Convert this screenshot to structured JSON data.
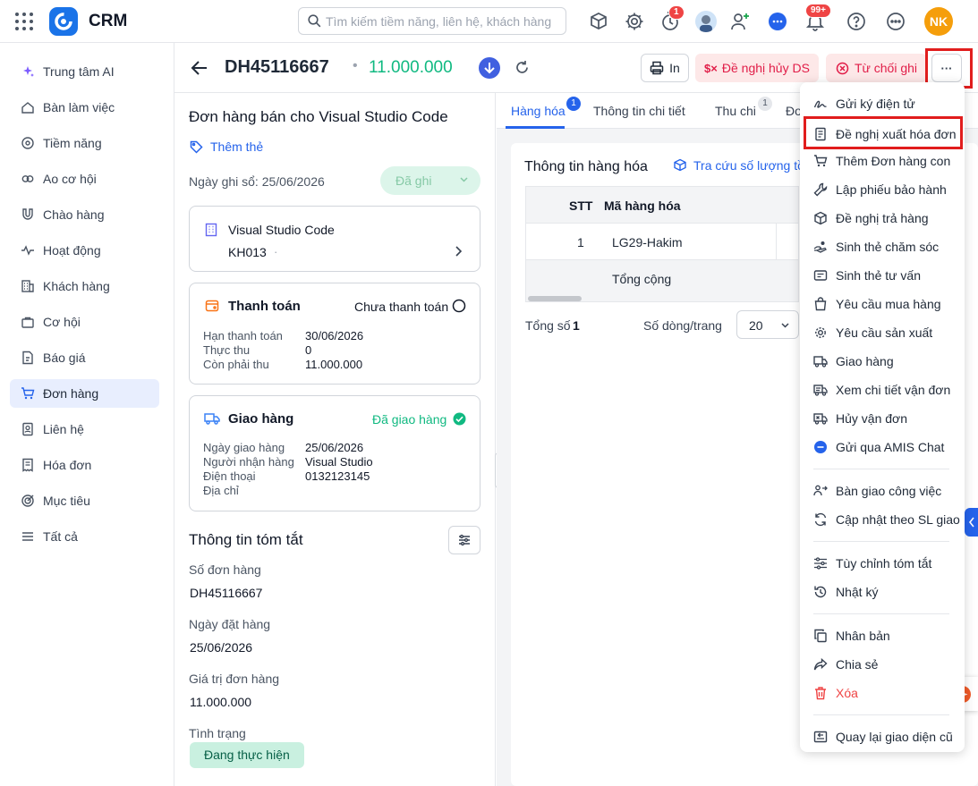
{
  "app": {
    "name": "CRM"
  },
  "search": {
    "placeholder": "Tìm kiếm tiềm năng, liên hệ, khách hàng"
  },
  "topbar": {
    "timer_badge": "1",
    "notif_badge": "99+",
    "user_initials": "NK",
    "brand_color": "#1a73e8",
    "avatar_color": "#f59e0b"
  },
  "sidebar": {
    "items": [
      {
        "label": "Trung tâm AI",
        "icon": "sparkle-icon"
      },
      {
        "label": "Bàn làm việc",
        "icon": "home-icon"
      },
      {
        "label": "Tiềm năng",
        "icon": "target-icon"
      },
      {
        "label": "Ao cơ hội",
        "icon": "pond-icon"
      },
      {
        "label": "Chào hàng",
        "icon": "magnet-icon"
      },
      {
        "label": "Hoạt động",
        "icon": "pulse-icon"
      },
      {
        "label": "Khách hàng",
        "icon": "building-icon"
      },
      {
        "label": "Cơ hội",
        "icon": "bag-icon"
      },
      {
        "label": "Báo giá",
        "icon": "quote-icon"
      },
      {
        "label": "Đơn hàng",
        "icon": "cart-icon"
      },
      {
        "label": "Liên hệ",
        "icon": "contact-icon"
      },
      {
        "label": "Hóa đơn",
        "icon": "invoice-icon"
      },
      {
        "label": "Mục tiêu",
        "icon": "goal-icon"
      },
      {
        "label": "Tất cả",
        "icon": "menu-icon"
      }
    ],
    "active_index": 9
  },
  "header": {
    "order_code": "DH45116667",
    "dot": "•",
    "amount": "11.000.000",
    "print_label": "In",
    "cancel_label": "Đề nghị hủy DS",
    "reject_label": "Từ chối ghi",
    "more_label": "···"
  },
  "left": {
    "title": "Đơn hàng bán cho Visual Studio Code",
    "add_tag": "Thêm thẻ",
    "record_date": "Ngày ghi sổ: 25/06/2026",
    "status_select": "Đã ghi",
    "customer": {
      "name": "Visual Studio Code",
      "code": "KH013",
      "sep": "·"
    },
    "payment": {
      "title": "Thanh toán",
      "status": "Chưa thanh toán",
      "rows": [
        {
          "label": "Hạn thanh toán",
          "value": "30/06/2026"
        },
        {
          "label": "Thực thu",
          "value": "0"
        },
        {
          "label": "Còn phải thu",
          "value": "11.000.000"
        }
      ]
    },
    "delivery": {
      "title": "Giao hàng",
      "status": "Đã giao hàng",
      "rows": [
        {
          "label": "Ngày giao hàng",
          "value": "25/06/2026"
        },
        {
          "label": "Người nhận hàng",
          "value": "Visual Studio"
        },
        {
          "label": "Điện thoại",
          "value": "0132123145"
        },
        {
          "label": "Địa chỉ",
          "value": ""
        }
      ]
    },
    "summary": {
      "title": "Thông tin tóm tắt",
      "fields": [
        {
          "label": "Số đơn hàng",
          "value": "DH45116667"
        },
        {
          "label": "Ngày đặt hàng",
          "value": "25/06/2026"
        },
        {
          "label": "Giá trị đơn hàng",
          "value": "11.000.000"
        }
      ],
      "status_label": "Tình trạng",
      "status_value": "Đang thực hiện"
    }
  },
  "tabs": {
    "items": [
      {
        "label": "Hàng hóa",
        "badge": "1"
      },
      {
        "label": "Thông tin chi tiết",
        "badge": ""
      },
      {
        "label": "Thu chi",
        "badge": "1"
      },
      {
        "label": "Đơ",
        "badge": ""
      }
    ],
    "active_index": 0
  },
  "goods": {
    "title": "Thông tin hàng hóa",
    "lookup": "Tra cứu số lượng tồ",
    "columns": [
      "STT",
      "Mã hàng hóa"
    ],
    "rows": [
      {
        "stt": "1",
        "code": "LG29-Hakim"
      }
    ],
    "total_label": "Tổng cộng",
    "total_count_label": "Tổng số",
    "total_count": "1",
    "page_size_label": "Số dòng/trang",
    "page_size": "20"
  },
  "menu": {
    "items": [
      {
        "label": "Gửi ký điện tử",
        "icon": "signature-icon"
      },
      {
        "label": "Đề nghị xuất hóa đơn",
        "icon": "invoice-request-icon"
      },
      {
        "label": "Thêm Đơn hàng con",
        "icon": "cart-add-icon"
      },
      {
        "label": "Lập phiếu bảo hành",
        "icon": "wrench-icon"
      },
      {
        "label": "Đề nghị trả hàng",
        "icon": "box-return-icon"
      },
      {
        "label": "Sinh thẻ chăm sóc",
        "icon": "care-hand-icon"
      },
      {
        "label": "Sinh thẻ tư vấn",
        "icon": "consult-card-icon"
      },
      {
        "label": "Yêu cầu mua hàng",
        "icon": "purchase-bag-icon"
      },
      {
        "label": "Yêu cầu sản xuất",
        "icon": "production-gear-icon"
      },
      {
        "label": "Giao hàng",
        "icon": "truck-icon"
      },
      {
        "label": "Xem chi tiết vận đơn",
        "icon": "waybill-truck-icon"
      },
      {
        "label": "Hủy vận đơn",
        "icon": "cancel-waybill-icon"
      },
      {
        "label": "Gửi qua AMIS Chat",
        "icon": "chat-icon"
      },
      {
        "label": "Bàn giao công việc",
        "icon": "handover-icon"
      },
      {
        "label": "Cập nhật theo SL giao",
        "icon": "refresh-icon"
      },
      {
        "label": "Tùy chỉnh tóm tắt",
        "icon": "sliders-icon"
      },
      {
        "label": "Nhật ký",
        "icon": "history-icon"
      },
      {
        "label": "Nhân bản",
        "icon": "copy-icon"
      },
      {
        "label": "Chia sẻ",
        "icon": "share-icon"
      },
      {
        "label": "Xóa",
        "icon": "trash-icon"
      },
      {
        "label": "Quay lại giao diện cũ",
        "icon": "back-layout-icon"
      }
    ]
  }
}
